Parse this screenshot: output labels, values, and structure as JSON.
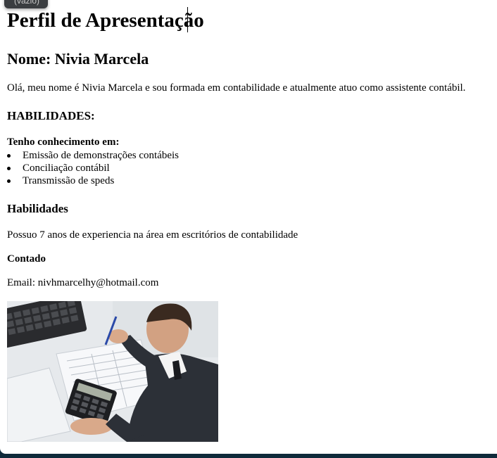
{
  "tooltip": {
    "text": "(vazio)"
  },
  "profile": {
    "title": "Perfil de Apresentação",
    "name_heading": "Nome: Nivia Marcela",
    "intro": "Olá, meu nome é Nivia Marcela e sou formada em contabilidade e atualmente atuo como assistente contábil.",
    "skills_heading": "HABILIDADES:",
    "knowledge_label": "Tenho conhecimento em:",
    "knowledge_items": [
      "Emissão de demonstrações contábeis",
      "Conciliação contábil",
      "Transmissão de speds"
    ],
    "habilidades_heading": "Habilidades",
    "experience": "Possuo 7 anos de experiencia na área em escritórios de contabilidade",
    "contact_heading": "Contado",
    "email": "Email: nivhmarcelhy@hotmail.com"
  },
  "photo": {
    "icon": "accountant-photo"
  }
}
